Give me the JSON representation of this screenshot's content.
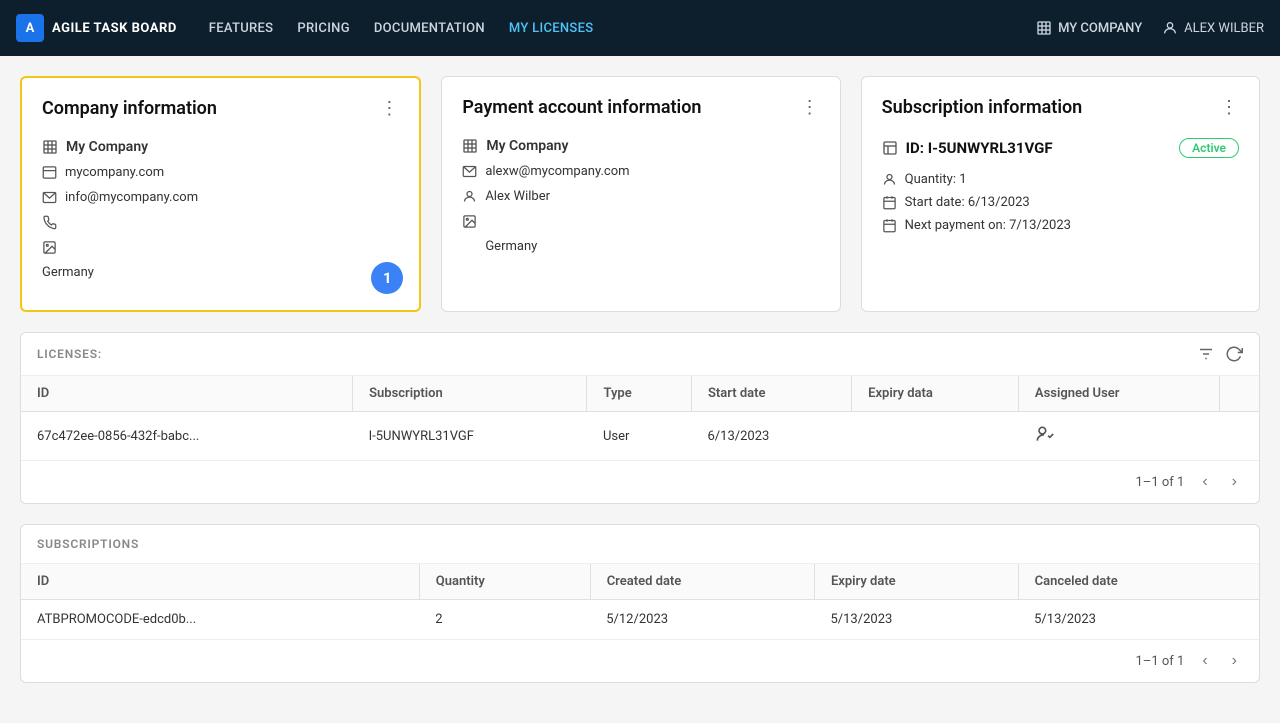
{
  "navbar": {
    "logo_text": "A",
    "brand_name": "AGILE TASK BOARD",
    "links": [
      {
        "label": "FEATURES",
        "active": false
      },
      {
        "label": "PRICING",
        "active": false
      },
      {
        "label": "DOCUMENTATION",
        "active": false
      },
      {
        "label": "MY LICENSES",
        "active": true
      }
    ],
    "my_company_label": "MY COMPANY",
    "user_label": "ALEX WILBER"
  },
  "company_card": {
    "title": "Company information",
    "company_name": "My Company",
    "website": "mycompany.com",
    "email": "info@mycompany.com",
    "country": "Germany",
    "badge_number": "1"
  },
  "payment_card": {
    "title": "Payment account information",
    "company_name": "My Company",
    "email": "alexw@mycompany.com",
    "user_name": "Alex Wilber",
    "country": "Germany"
  },
  "subscription_card": {
    "title": "Subscription information",
    "id_label": "ID: I-5UNWYRL31VGF",
    "status": "Active",
    "quantity_label": "Quantity: 1",
    "start_date_label": "Start date: 6/13/2023",
    "next_payment_label": "Next payment on: 7/13/2023"
  },
  "licenses_section": {
    "title": "LICENSES:",
    "columns": [
      "ID",
      "Subscription",
      "Type",
      "Start date",
      "Expiry data",
      "Assigned User"
    ],
    "rows": [
      {
        "id": "67c472ee-0856-432f-babc...",
        "subscription": "I-5UNWYRL31VGF",
        "type": "User",
        "start_date": "6/13/2023",
        "expiry_date": "",
        "assigned_user_icon": true
      }
    ],
    "pagination": "1–1 of 1"
  },
  "subscriptions_section": {
    "title": "SUBSCRIPTIONS",
    "columns": [
      "ID",
      "Quantity",
      "Created date",
      "Expiry date",
      "Canceled date"
    ],
    "rows": [
      {
        "id": "ATBPROMOCODE-edcd0b...",
        "quantity": "2",
        "created_date": "5/12/2023",
        "expiry_date": "5/13/2023",
        "canceled_date": "5/13/2023"
      }
    ],
    "pagination": "1–1 of 1"
  }
}
